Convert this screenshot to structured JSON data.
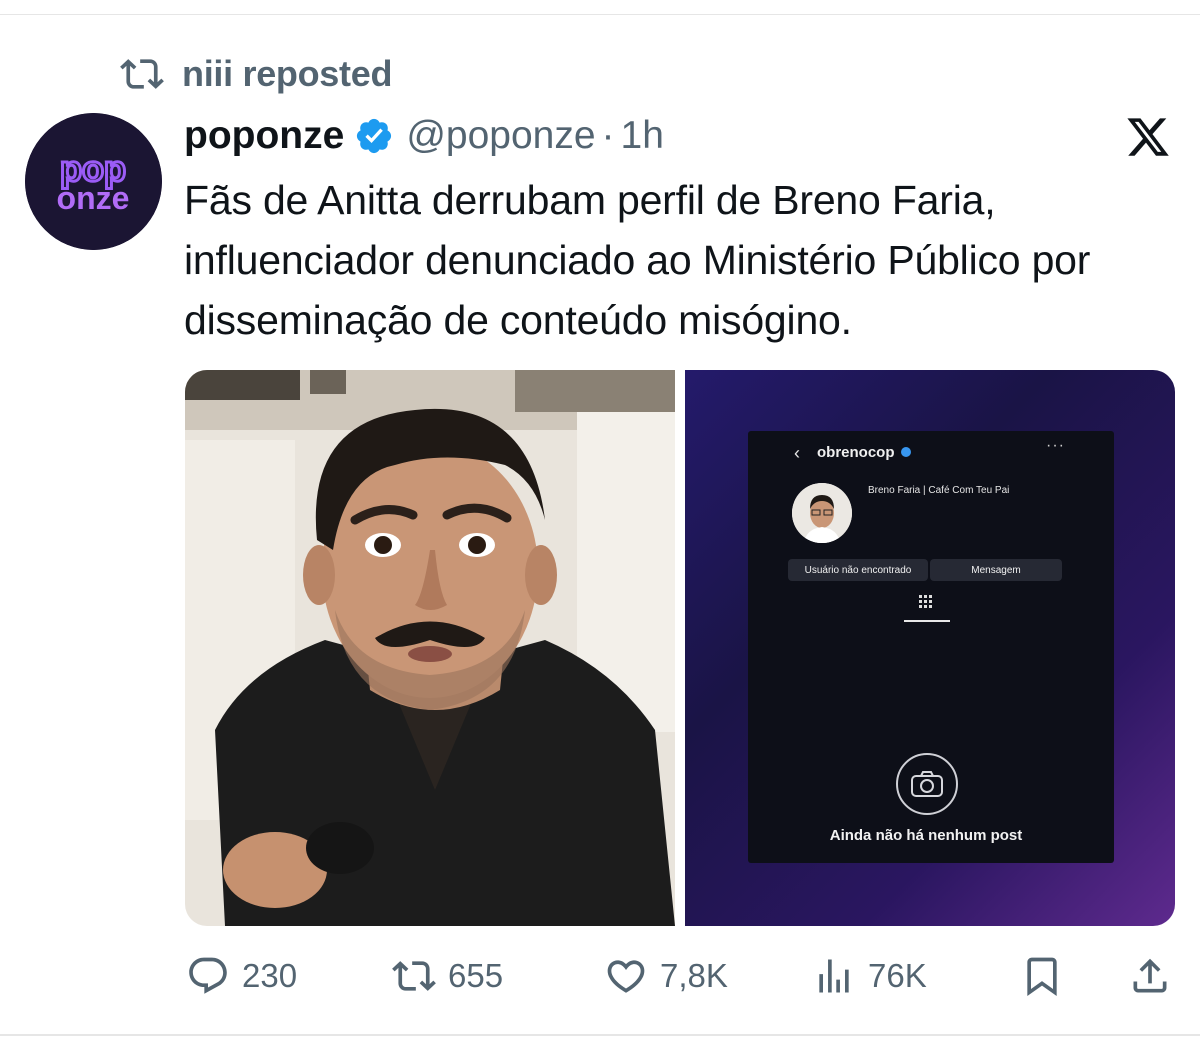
{
  "repost": {
    "label": "niii reposted",
    "icon": "repost-icon"
  },
  "author": {
    "avatar_text_top": "pop",
    "avatar_text_bottom": "onze",
    "display_name": "poponze",
    "handle": "@poponze",
    "separator": "·",
    "time": "1h",
    "verified_color": "#1d9bf0"
  },
  "platform_logo": "x-logo-icon",
  "tweet": {
    "text": "Fãs de Anitta derrubam perfil de Breno Faria, influenciador denunciado ao Ministério Público por disseminação de conteúdo misógino."
  },
  "media_right": {
    "back_glyph": "‹",
    "profile_handle": "obrenocop",
    "menu_glyph": "···",
    "profile_name": "Breno Faria | Café Com Teu Pai",
    "button_user": "Usuário não encontrado",
    "button_message": "Mensagem",
    "empty_state": "Ainda não há nenhum post"
  },
  "actions": {
    "reply_count": "230",
    "repost_count": "655",
    "like_count": "7,8K",
    "views_count": "76K"
  },
  "colors": {
    "text_primary": "#0f1419",
    "text_secondary": "#536471",
    "accent": "#1d9bf0",
    "avatar_bg": "#1b1533",
    "avatar_text": "#9b5cf6"
  }
}
